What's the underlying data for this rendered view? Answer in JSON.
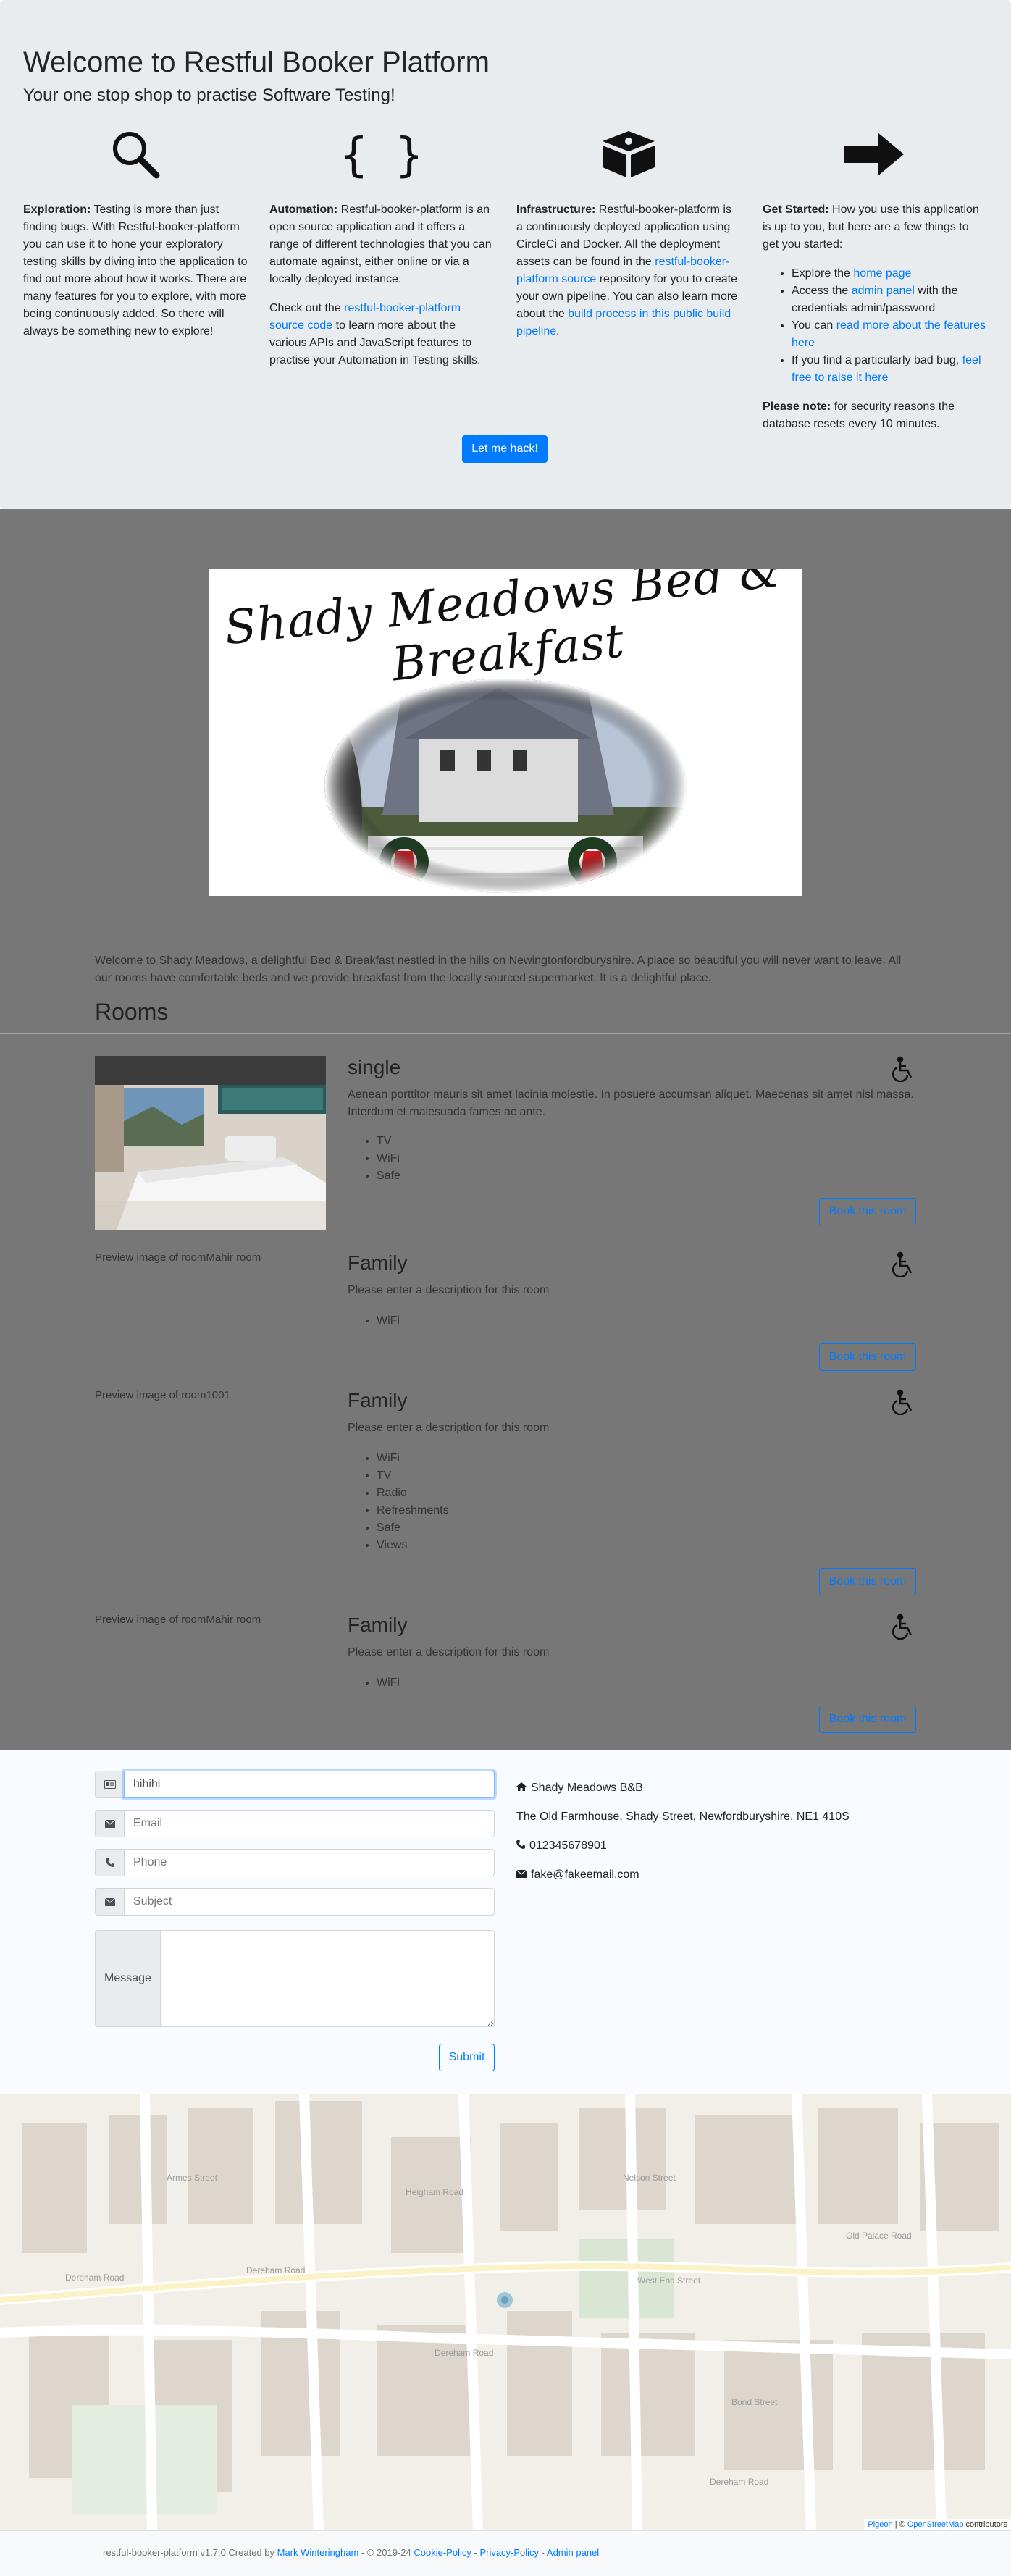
{
  "jumbotron": {
    "title": "Welcome to Restful Booker Platform",
    "subtitle": "Your one stop shop to practise Software Testing!",
    "features": {
      "exploration": {
        "icon": "search-icon",
        "heading": "Exploration:",
        "text": " Testing is more than just finding bugs. With Restful-booker-platform you can use it to hone your exploratory testing skills by diving into the application to find out more about how it works. There are many features for you to explore, with more being continuously added. So there will always be something new to explore!"
      },
      "automation": {
        "icon": "curly-braces-icon",
        "heading": "Automation:",
        "text": " Restful-booker-platform is an open source application and it offers a range of different technologies that you can automate against, either online or via a locally deployed instance.",
        "p2_before": "Check out the ",
        "p2_link": "restful-booker-platform source code",
        "p2_after": " to learn more about the various APIs and JavaScript features to practise your Automation in Testing skills."
      },
      "infrastructure": {
        "icon": "cube-icon",
        "heading": "Infrastructure:",
        "text_1": " Restful-booker-platform is a continuously deployed application using CircleCi and Docker. All the deployment assets can be found in the ",
        "link_1": "restful-booker-platform source",
        "text_2": " repository for you to create your own pipeline. You can also learn more about the ",
        "link_2": "build process in this public build pipeline",
        "text_3": "."
      },
      "get_started": {
        "icon": "arrow-right-icon",
        "heading": "Get Started:",
        "text": " How you use this application is up to you, but here are a few things to get you started:",
        "items": {
          "home": {
            "before": "Explore the ",
            "link": "home page",
            "after": ""
          },
          "admin": {
            "before": "Access the ",
            "link": "admin panel",
            "after": " with the credentials admin/password"
          },
          "features": {
            "before": "You can ",
            "link": "read more about the features here",
            "after": ""
          },
          "bug": {
            "before": "If you find a particularly bad bug, ",
            "link": "feel free to raise it here",
            "after": ""
          }
        },
        "note_heading": "Please note:",
        "note_text": " for security reasons the database resets every 10 minutes."
      }
    },
    "hack_button": "Let me hack!"
  },
  "hotel": {
    "logo_text": "Shady Meadows Bed & Breakfast",
    "intro": "Welcome to Shady Meadows, a delightful Bed & Breakfast nestled in the hills on Newingtonfordburyshire. A place so beautiful you will never want to leave. All our rooms have comfortable beds and we provide breakfast from the locally sourced supermarket. It is a delightful place.",
    "rooms_heading": "Rooms",
    "book_label": "Book this room",
    "rooms": [
      {
        "name": "single",
        "alt": "",
        "description": "Aenean porttitor mauris sit amet lacinia molestie. In posuere accumsan aliquet. Maecenas sit amet nisl massa. Interdum et malesuada fames ac ante.",
        "features": [
          "TV",
          "WiFi",
          "Safe"
        ]
      },
      {
        "name": "Family",
        "alt": "Preview image of roomMahir room",
        "description": "Please enter a description for this room",
        "features": [
          "WiFi"
        ]
      },
      {
        "name": "Family",
        "alt": "Preview image of room1001",
        "description": "Please enter a description for this room",
        "features": [
          "WiFi",
          "TV",
          "Radio",
          "Refreshments",
          "Safe",
          "Views"
        ]
      },
      {
        "name": "Family",
        "alt": "Preview image of roomMahir room",
        "description": "Please enter a description for this room",
        "features": [
          "WiFi"
        ]
      }
    ]
  },
  "contact": {
    "name_value": "hihihi",
    "email_placeholder": "Email",
    "phone_placeholder": "Phone",
    "subject_placeholder": "Subject",
    "message_label": "Message",
    "submit": "Submit",
    "business_name": "Shady Meadows B&B",
    "address": "The Old Farmhouse, Shady Street, Newfordburyshire, NE1 410S",
    "phone": "012345678901",
    "email": "fake@fakeemail.com"
  },
  "map": {
    "streets": [
      "Dereham Road",
      "Dereham Road",
      "Dereham Road",
      "Dereham Road",
      "West End Street",
      "Nelson Street",
      "Old Palace Road",
      "Heigham Road",
      "Armes Street",
      "Bond Street"
    ],
    "attribution_link_1": "Pigeon",
    "attribution_sep": " | © ",
    "attribution_link_2": "OpenStreetMap",
    "attribution_after": " contributors"
  },
  "footer": {
    "text_1": "restful-booker-platform v1.7.0 Created by ",
    "author": "Mark Winteringham",
    "text_2": " - © 2019-24 ",
    "cookie": "Cookie-Policy",
    "sep_1": " - ",
    "privacy": "Privacy-Policy",
    "sep_2": " - ",
    "admin": "Admin panel"
  },
  "colors": {
    "primary": "#007bff",
    "jumbotron_bg": "#e9ecef",
    "hotel_bg": "#777777",
    "contact_bg": "#f8fbff"
  }
}
